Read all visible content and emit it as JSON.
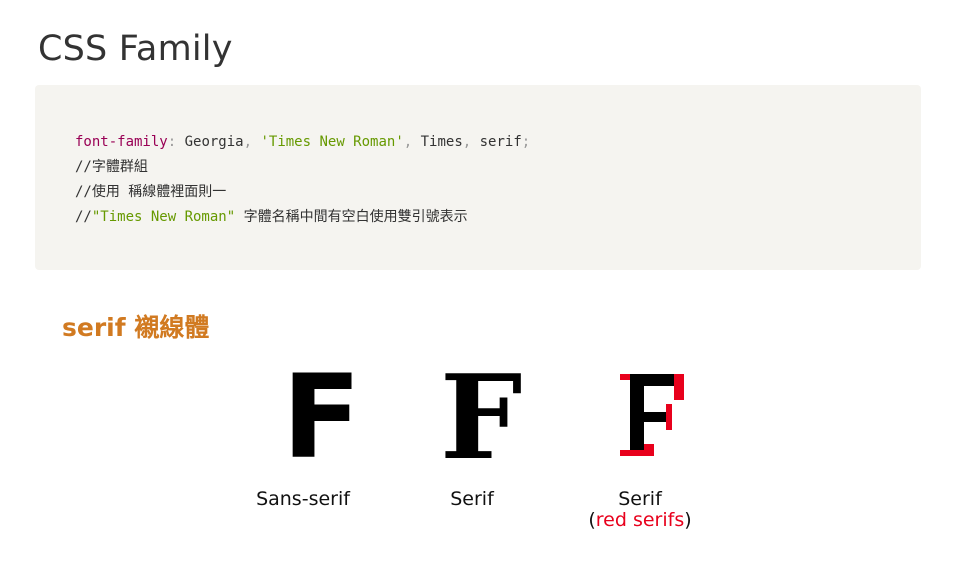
{
  "page": {
    "title": "CSS Family"
  },
  "code": {
    "line1": {
      "property": "font-family",
      "colon": ":",
      "value1": " Georgia",
      "comma1": ",",
      "string1": " 'Times New Roman'",
      "comma2": ",",
      "value2": " Times",
      "comma3": ",",
      "value3": " serif",
      "semicolon": ";"
    },
    "line2": "//字體群組",
    "line3": "//使用 稱線體裡面則一",
    "line4": {
      "prefix": "//",
      "string": "\"Times New Roman\"",
      "rest": " 字體名稱中間有空白使用雙引號表示"
    }
  },
  "section": {
    "heading": "serif 襯線體"
  },
  "figure": {
    "glyph_sans": "F",
    "glyph_serif": "F",
    "label_sans": "Sans-serif",
    "label_serif": "Serif",
    "label_red_serif": "Serif",
    "label_red_open": "(",
    "label_red_highlight": "red serifs",
    "label_red_close": ")",
    "colors": {
      "highlight": "#e8001c",
      "glyph": "#000000"
    }
  },
  "colors": {
    "title": "#333333",
    "heading": "#d17a21",
    "code_background": "#f5f4f0",
    "code_property": "#990055",
    "code_string": "#669900"
  }
}
